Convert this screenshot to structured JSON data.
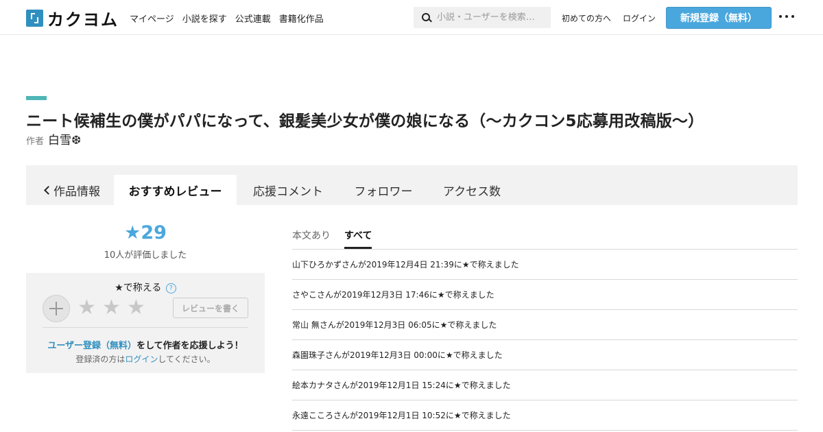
{
  "header": {
    "logo_text": "カクヨム",
    "nav": [
      "マイページ",
      "小説を探す",
      "公式連載",
      "書籍化作品"
    ],
    "search_placeholder": "小説・ユーザーを検索…",
    "first_time": "初めての方へ",
    "login": "ログイン",
    "signup": "新規登録（無料）",
    "brand_color": "#4aa7dd"
  },
  "work": {
    "title": "ニート候補生の僕がパパになって、銀髪美少女が僕の娘になる（～カクコン5応募用改稿版～）",
    "author_label": "作者",
    "author_name": "白雪❆"
  },
  "tabs": [
    "作品情報",
    "おすすめレビュー",
    "応援コメント",
    "フォロワー",
    "アクセス数"
  ],
  "active_tab": "おすすめレビュー",
  "rating": {
    "total": "★29",
    "raters": "10人が評価しました",
    "praise_title": "★で称える",
    "help": "?",
    "stars": [
      "★",
      "★",
      "★"
    ],
    "write_review": "レビューを書く",
    "cta_link": "ユーザー登録（無料）",
    "cta_rest": "をして作者を応援しよう！",
    "login_pre": "登録済の方は",
    "login_link": "ログイン",
    "login_post": "してください。"
  },
  "review_filter": {
    "with_text": "本文あり",
    "all": "すべて"
  },
  "reviews": [
    "山下ひろかずさんが2019年12月4日 21:39に★で称えました",
    "さやこさんが2019年12月3日 17:46に★で称えました",
    "常山 無さんが2019年12月3日 06:05に★で称えました",
    "森園珠子さんが2019年12月3日 00:00に★で称えました",
    "絵本カナタさんが2019年12月1日 15:24に★で称えました",
    "永遠こころさんが2019年12月1日 10:52に★で称えました"
  ]
}
